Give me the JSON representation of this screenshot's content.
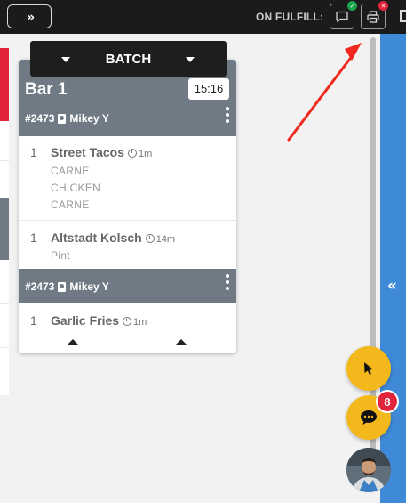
{
  "topbar": {
    "expand_glyph": "»",
    "fulfill_label": "ON FULFILL:",
    "message_icon": "message-icon",
    "print_icon": "printer-icon",
    "status_ok_color": "#1aa64b",
    "status_error_color": "#e2243b"
  },
  "batch": {
    "label": "BATCH"
  },
  "card": {
    "station": "Bar 1",
    "timer": "15:16",
    "header_color": "#6f7a84",
    "orders": [
      {
        "number": "#2473",
        "customer": "Mikey Y",
        "items": [
          {
            "qty": "1",
            "name": "Street Tacos",
            "age": "1m",
            "modifiers": [
              "CARNE",
              "CHICKEN",
              "CARNE"
            ]
          },
          {
            "qty": "1",
            "name": "Altstadt Kolsch",
            "age": "14m",
            "modifiers": [
              "Pint"
            ]
          }
        ]
      },
      {
        "number": "#2473",
        "customer": "Mikey Y",
        "items": [
          {
            "qty": "1",
            "name": "Garlic Fries",
            "age": "1m",
            "modifiers": []
          }
        ]
      }
    ]
  },
  "side_panel": {
    "collapse_glyph": "«",
    "color": "#3f8ad8"
  },
  "chat": {
    "unread_count": "8",
    "fab_color": "#f3b81b"
  },
  "left_columns": {
    "accent_red": "#e2243b",
    "accent_gray": "#6f7a84"
  }
}
